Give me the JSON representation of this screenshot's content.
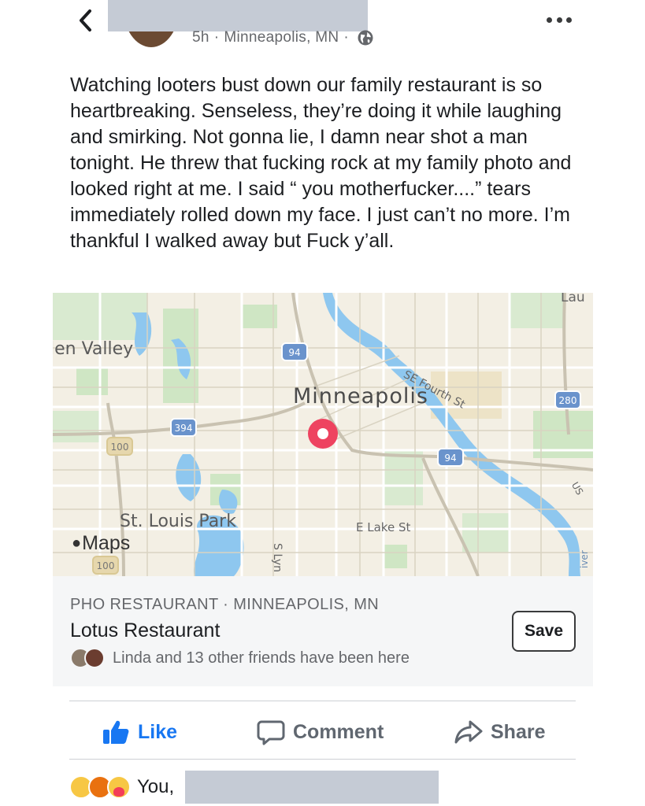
{
  "header": {
    "back_icon": "chevron-left-icon",
    "post_meta_time": "5h",
    "post_meta_location": "Minneapolis, MN",
    "separator": "·",
    "privacy_icon": "globe-icon",
    "more_icon": "more-horizontal-icon"
  },
  "post": {
    "text": "Watching looters bust down our family restaurant is so heartbreaking. Senseless, they’re doing it while laughing and smirking. Not gonna lie, I damn near shot a man tonight. He threw that fucking rock at my family photo and looked right at me. I said “ you motherfucker....” tears immediately rolled down my face. I just can’t no more. I’m thankful I walked away but Fuck y’all."
  },
  "map": {
    "city_label": "Minneapolis",
    "labels": {
      "glen_valley": "len Valley",
      "st_louis_park": "St. Louis Park",
      "e_lake_st": "E Lake St",
      "se_fourth_st": "SE Fourth St",
      "lau": "Lau",
      "s_lyn": "S Lyn",
      "us": "US",
      "river": "iver"
    },
    "shields": {
      "i94_west": "94",
      "i94_east": "94",
      "i394": "394",
      "i280": "280",
      "us100_top": "100",
      "us100_bottom": "100"
    },
    "provider": "Maps",
    "provider_icon": "apple-logo-icon",
    "pin_icon": "location-pin-icon",
    "colors": {
      "land": "#f3efe4",
      "park": "#cfe6c4",
      "water": "#8ec7ef",
      "pin": "#ee4360",
      "highway_shield": "#6a93cc"
    }
  },
  "place": {
    "category": "PHO RESTAURANT · MINNEAPOLIS, MN",
    "name": "Lotus Restaurant",
    "friends_text": "Linda and 13 other friends have been here",
    "save_label": "Save"
  },
  "actions": {
    "like_label": "Like",
    "comment_label": "Comment",
    "share_label": "Share",
    "like_color": "#1877f2"
  },
  "reactions": {
    "icons": [
      "sad-emoji-icon",
      "angry-emoji-icon",
      "care-emoji-icon"
    ],
    "summary_prefix": "You,"
  }
}
